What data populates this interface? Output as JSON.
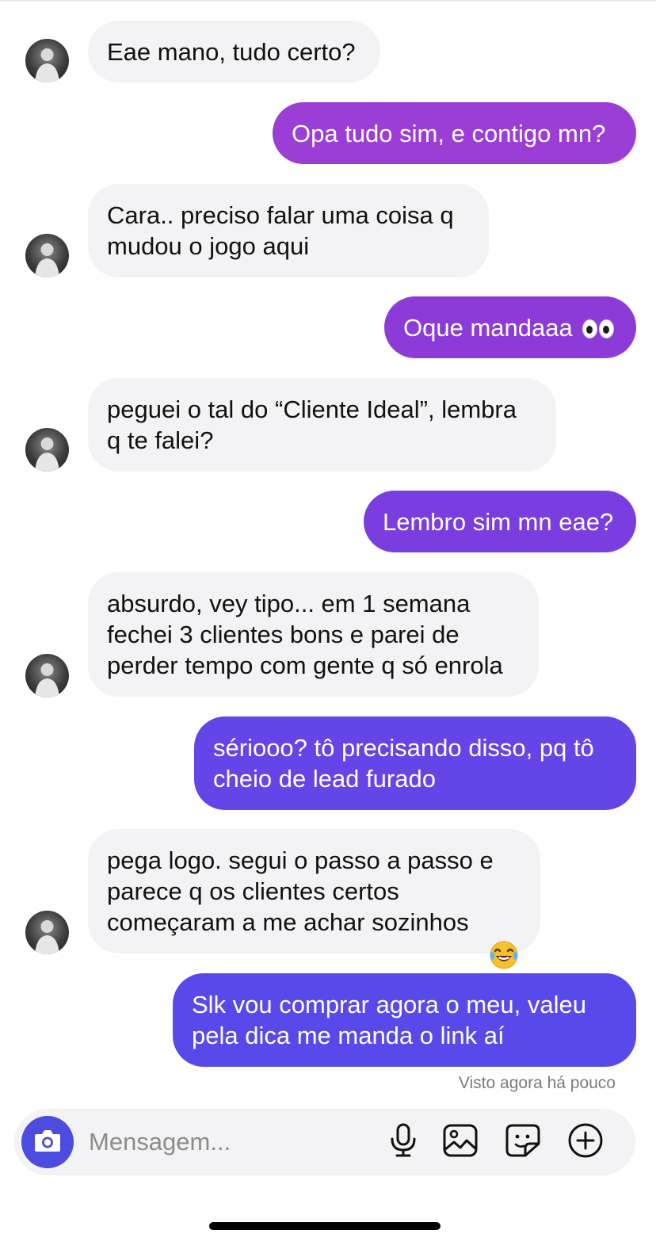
{
  "messages": [
    {
      "dir": "in",
      "text": "Eae mano, tudo certo?"
    },
    {
      "dir": "out",
      "text": "Opa tudo sim, e contigo mn?",
      "color": "#9b3ed6"
    },
    {
      "dir": "in",
      "text": "Cara.. preciso falar uma coisa q\nmudou o jogo aqui"
    },
    {
      "dir": "out",
      "text": "Oque mandaaa",
      "emoji": "eyes-icon",
      "color": "#8c3ad8"
    },
    {
      "dir": "in",
      "text": "peguei o tal do “Cliente Ideal”, lembra\nq te falei?"
    },
    {
      "dir": "out",
      "text": "Lembro sim mn eae?",
      "color": "#7a3ee0"
    },
    {
      "dir": "in",
      "text": "absurdo, vey tipo... em 1 semana\nfechei 3 clientes bons e parei de\nperder tempo com gente q só enrola"
    },
    {
      "dir": "out",
      "text": "sériooo? tô precisando disso, pq tô\ncheio de lead furado",
      "color": "#6345e8"
    },
    {
      "dir": "in",
      "text": "pega logo. segui o passo a passo e\nparece q os clientes certos\ncomeçaram a me achar sozinhos",
      "emoji": "tears-of-joy-icon"
    },
    {
      "dir": "out",
      "text": "Slk vou comprar agora  o meu,  valeu\npela dica me manda o link aí",
      "color": "#584aea"
    }
  ],
  "seen_label": "Visto agora há pouco",
  "composer": {
    "placeholder": "Mensagem...",
    "camera_color": "#4c4de0"
  }
}
